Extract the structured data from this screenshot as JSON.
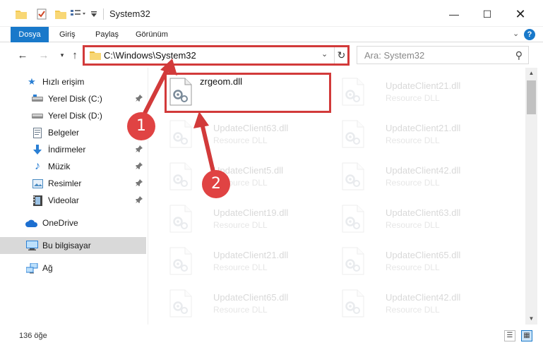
{
  "window": {
    "title": "System32",
    "minimize_glyph": "—",
    "maximize_glyph": "☐",
    "close_glyph": "✕"
  },
  "ribbon": {
    "tabs": [
      "Dosya",
      "Giriş",
      "Paylaş",
      "Görünüm"
    ],
    "accent_color": "#1979ca",
    "help_glyph": "?",
    "expand_glyph": "⌄"
  },
  "navigation": {
    "back_glyph": "←",
    "forward_glyph": "→",
    "recent_glyph": "▾",
    "up_glyph": "↑",
    "address": "C:\\Windows\\System32",
    "dropdown_glyph": "⌄",
    "refresh_glyph": "↻",
    "search_placeholder": "Ara: System32",
    "search_glyph": "⚲"
  },
  "sidebar": {
    "items": [
      {
        "label": "Hızlı erişim",
        "icon": "star-icon",
        "glyph": "★",
        "color": "#2a7fd4",
        "pinned": false
      },
      {
        "label": "Yerel Disk (C:)",
        "icon": "drive-icon",
        "glyph": "▬",
        "color": "#555555",
        "pinned": true
      },
      {
        "label": "Yerel Disk (D:)",
        "icon": "drive-icon",
        "glyph": "▬",
        "color": "#555555",
        "pinned": false
      },
      {
        "label": "Belgeler",
        "icon": "documents-icon",
        "glyph": "▤",
        "color": "#6b7b8c",
        "pinned": true
      },
      {
        "label": "İndirmeler",
        "icon": "download-icon",
        "glyph": "⬇",
        "color": "#2a7fd4",
        "pinned": true
      },
      {
        "label": "Müzik",
        "icon": "music-icon",
        "glyph": "♪",
        "color": "#2a7fd4",
        "pinned": true
      },
      {
        "label": "Resimler",
        "icon": "pictures-icon",
        "glyph": "▧",
        "color": "#4a8bc2",
        "pinned": true
      },
      {
        "label": "Videolar",
        "icon": "video-icon",
        "glyph": "▦",
        "color": "#444444",
        "pinned": true
      },
      {
        "label": "OneDrive",
        "icon": "cloud-icon",
        "glyph": "☁",
        "color": "#1d6fd0",
        "pinned": false
      },
      {
        "label": "Bu bilgisayar",
        "icon": "computer-icon",
        "glyph": "▭",
        "color": "#2a7fd4",
        "pinned": false
      },
      {
        "label": "Ağ",
        "icon": "network-icon",
        "glyph": "⛁",
        "color": "#2a7fd4",
        "pinned": false
      }
    ],
    "pin_glyph": "📌"
  },
  "files": [
    {
      "name": "zrgeom.dll",
      "type": "",
      "faded": false
    },
    {
      "name": "UpdateClient21.dll",
      "type": "Resource DLL",
      "faded": true
    },
    {
      "name": "UpdateClient63.dll",
      "type": "Resource DLL",
      "faded": true
    },
    {
      "name": "UpdateClient21.dll",
      "type": "Resource DLL",
      "faded": true
    },
    {
      "name": "UpdateClient5.dll",
      "type": "Resource DLL",
      "faded": true
    },
    {
      "name": "UpdateClient42.dll",
      "type": "Resource DLL",
      "faded": true
    },
    {
      "name": "UpdateClient19.dll",
      "type": "Resource DLL",
      "faded": true
    },
    {
      "name": "UpdateClient63.dll",
      "type": "Resource DLL",
      "faded": true
    },
    {
      "name": "UpdateClient21.dll",
      "type": "Resource DLL",
      "faded": true
    },
    {
      "name": "UpdateClient65.dll",
      "type": "Resource DLL",
      "faded": true
    },
    {
      "name": "UpdateClient65.dll",
      "type": "Resource DLL",
      "faded": true
    },
    {
      "name": "UpdateClient42.dll",
      "type": "Resource DLL",
      "faded": true
    }
  ],
  "status": {
    "item_count": "136 öğe"
  },
  "annotations": {
    "step1": "1",
    "step2": "2",
    "color": "#d23a3a"
  }
}
